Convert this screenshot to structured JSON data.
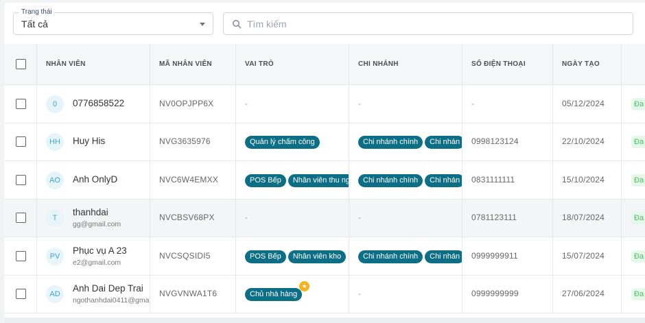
{
  "filters": {
    "status_label": "Trạng thái",
    "status_value": "Tất cả",
    "search_placeholder": "Tìm kiếm"
  },
  "table": {
    "headers": [
      "NHÂN VIÊN",
      "MÃ NHÂN VIÊN",
      "VAI TRÒ",
      "CHI NHÁNH",
      "SỐ ĐIỆN THOẠI",
      "NGÀY TẠO"
    ],
    "rows": [
      {
        "initials": "0",
        "name": "0776858522",
        "email": "",
        "code": "NV0OPJPP6X",
        "roles": [
          "-"
        ],
        "branches": [
          "-"
        ],
        "phone": "-",
        "created": "05/12/2024",
        "status": "Đa"
      },
      {
        "initials": "HH",
        "name": "Huy His",
        "email": "",
        "code": "NVG3635976",
        "roles": [
          "Quản lý chấm công"
        ],
        "branches": [
          "Chi nhánh chính",
          "Chi nhán"
        ],
        "phone": "0998123124",
        "created": "22/10/2024",
        "status": "Đa"
      },
      {
        "initials": "AO",
        "name": "Anh OnlyD",
        "email": "",
        "code": "NVC6W4EMXX",
        "roles": [
          "POS Bếp",
          "Nhân viên thu ng"
        ],
        "branches": [
          "Chi nhánh chính",
          "Chi nhán"
        ],
        "phone": "0831111111",
        "created": "15/10/2024",
        "status": "Đa"
      },
      {
        "initials": "T",
        "name": "thanhdai",
        "email": "gg@gmail.com",
        "code": "NVCBSV68PX",
        "roles": [
          "-"
        ],
        "branches": [
          "-"
        ],
        "phone": "0781123111",
        "created": "18/07/2024",
        "status": "Đa"
      },
      {
        "initials": "PV",
        "name": "Phục vụ A 23",
        "email": "e2@gmail.com",
        "code": "NVCSQSIDI5",
        "roles": [
          "POS Bếp",
          "Nhân viên kho"
        ],
        "branches": [
          "Chi nhánh chính",
          "Chi nhán"
        ],
        "phone": "0999999911",
        "created": "15/07/2024",
        "status": "Đa"
      },
      {
        "initials": "AD",
        "name": "Anh Dai Dep Trai",
        "email": "ngothanhdai0411@gma",
        "code": "NVGVNWA1T6",
        "roles": [
          "Chủ nhà hàng"
        ],
        "branches": [
          "-"
        ],
        "phone": "0999999999",
        "created": "27/06/2024",
        "status": "Đa"
      }
    ]
  },
  "icons": {
    "search": "search-icon",
    "caret": "chevron-down-icon",
    "star": "star-icon"
  },
  "colors": {
    "tag": "#0d6f85",
    "avatar_text": "#36a6d6",
    "status_text": "#47c061",
    "star": "#f6b21d"
  }
}
